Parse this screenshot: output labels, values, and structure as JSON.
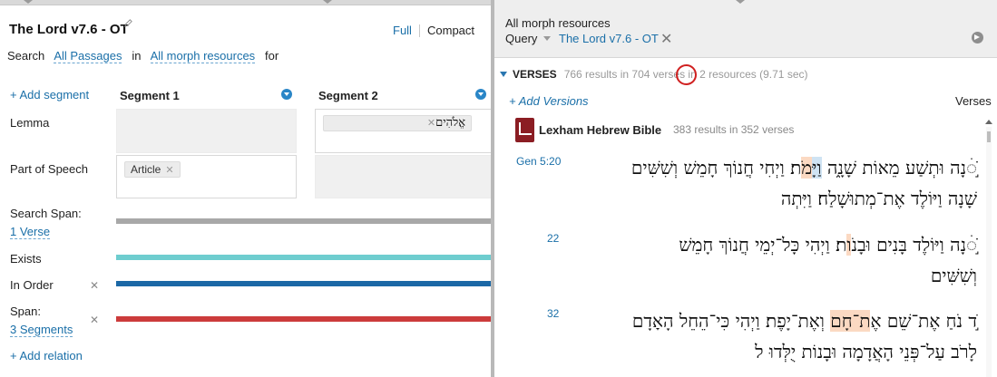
{
  "left": {
    "title": "The Lord v7.6 - OT",
    "view_full": "Full",
    "view_compact": "Compact",
    "search": {
      "prefix": "Search",
      "passages": "All Passages",
      "in": "in",
      "resources": "All morph resources",
      "for": "for"
    },
    "add_segment": "+ Add segment",
    "segments": [
      "Segment 1",
      "Segment 2"
    ],
    "rows": {
      "lemma": "Lemma",
      "part_of_speech": "Part of Speech",
      "search_span": "Search Span:",
      "search_span_value": "1 Verse",
      "exists": "Exists",
      "in_order": "In Order",
      "span": "Span:",
      "span_value": "3 Segments"
    },
    "chips": {
      "pos_seg1": "Article",
      "lemma_seg2": "אֱלֹהִים"
    },
    "add_relation": "+ Add relation",
    "colors": {
      "search_span_bar": "#a8a8a8",
      "exists_bar": "#6ecdcf",
      "in_order_bar": "#1b68a6",
      "span_bar": "#cc3b3b"
    }
  },
  "right": {
    "title": "All morph resources",
    "query_label": "Query",
    "query_name": "The Lord v7.6 - OT",
    "verses_label": "VERSES",
    "stats": "766 results in 704 verses in 2 resources (9.71 sec)",
    "add_versions": "+ Add Versions",
    "verses_column": "Verses",
    "book": {
      "name": "Lexham Hebrew Bible",
      "stat": "383 results in 352 verses"
    },
    "verses": [
      {
        "ref": "Gen 5:20",
        "line1": {
          "a": "ֹׂ֣◌ׄנָה וּתְשַׁע מֵאוֹת שָׁנָ֑ה ",
          "b": "וַיָּ",
          "c": "מֹ",
          "d": "ת׃ וַיְחִי חֲנוֹךְ חָמֵשׁ וְשִׁשִּׁים"
        },
        "line2": "שָׁנָה וַיּוֹלֶד אֶת־מְתוּשָׁלַח׃ וַיִּתְה"
      },
      {
        "ref": "22",
        "line1": {
          "a": "ֹׂ֣◌ׄנָה וַיּוֹלֶד בָּנִים וּבָנ",
          "b": "ֹו",
          "c": "ת׃ וַיְהִי כָּל־יְמֵי חֲנוֹךְ חָמֵשׁ",
          "d": ""
        },
        "line2": "וְשִׁשִּׁים"
      },
      {
        "ref": "32",
        "line1": {
          "a": "ֹ֣ד נֹחַ אֶת־שֵׁם א",
          "b": "ֶ",
          "c": "ת־חָם",
          "d": " וְאֶת־יָפֶת׃ וַיְהִי כִּי־הֵחֵל הָאָדָם"
        },
        "line2": "לָרֹב עַל־פְּנֵי הָאֲדָמָה וּבָנוֹת יֻלְּדוּ ל"
      }
    ]
  }
}
